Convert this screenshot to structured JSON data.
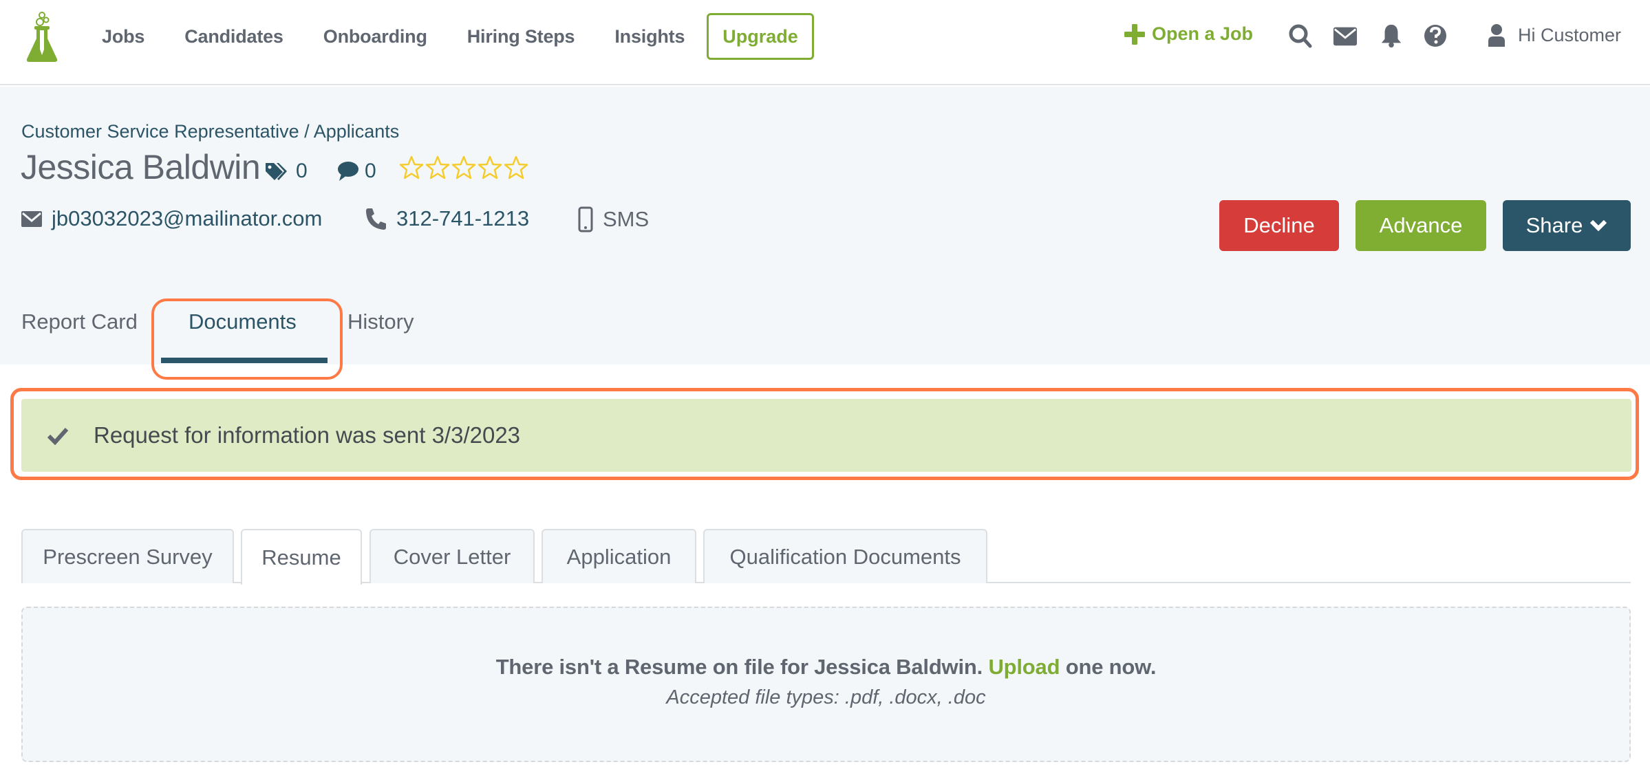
{
  "header": {
    "logo": "flask-logo",
    "nav": [
      "Jobs",
      "Candidates",
      "Onboarding",
      "Hiring Steps",
      "Insights"
    ],
    "upgrade_label": "Upgrade",
    "open_job_label": "Open a Job",
    "icons": [
      "search-icon",
      "envelope-icon",
      "bell-icon",
      "question-icon"
    ],
    "user_greeting": "Hi Customer"
  },
  "profile": {
    "breadcrumb": {
      "job": "Customer Service Representative",
      "separator": " / ",
      "section": "Applicants"
    },
    "name": "Jessica Baldwin",
    "tags_count": "0",
    "comments_count": "0",
    "rating": {
      "value": 0,
      "max": 5
    },
    "email": "jb03032023@mailinator.com",
    "phone": "312-741-1213",
    "sms_label": "SMS"
  },
  "actions": {
    "decline": "Decline",
    "advance": "Advance",
    "share": "Share"
  },
  "profile_tabs": [
    {
      "label": "Report Card",
      "active": false
    },
    {
      "label": "Documents",
      "active": true
    },
    {
      "label": "History",
      "active": false
    }
  ],
  "alert": {
    "text": "Request for information was sent 3/3/2023"
  },
  "document_tabs": [
    {
      "label": "Prescreen Survey",
      "active": false
    },
    {
      "label": "Resume",
      "active": true
    },
    {
      "label": "Cover Letter",
      "active": false
    },
    {
      "label": "Application",
      "active": false
    },
    {
      "label": "Qualification Documents",
      "active": false
    }
  ],
  "empty_state": {
    "prefix": "There isn't a Resume on file for Jessica Baldwin. ",
    "link": "Upload",
    "suffix": " one now.",
    "note": "Accepted file types: .pdf, .docx, .doc"
  },
  "colors": {
    "brand_green": "#7fad34",
    "decline_red": "#d63d3a",
    "share_navy": "#2b5569",
    "highlight_orange": "#fd7a46",
    "alert_bg": "#dfebc5",
    "star_yellow": "#f5cc2e"
  }
}
